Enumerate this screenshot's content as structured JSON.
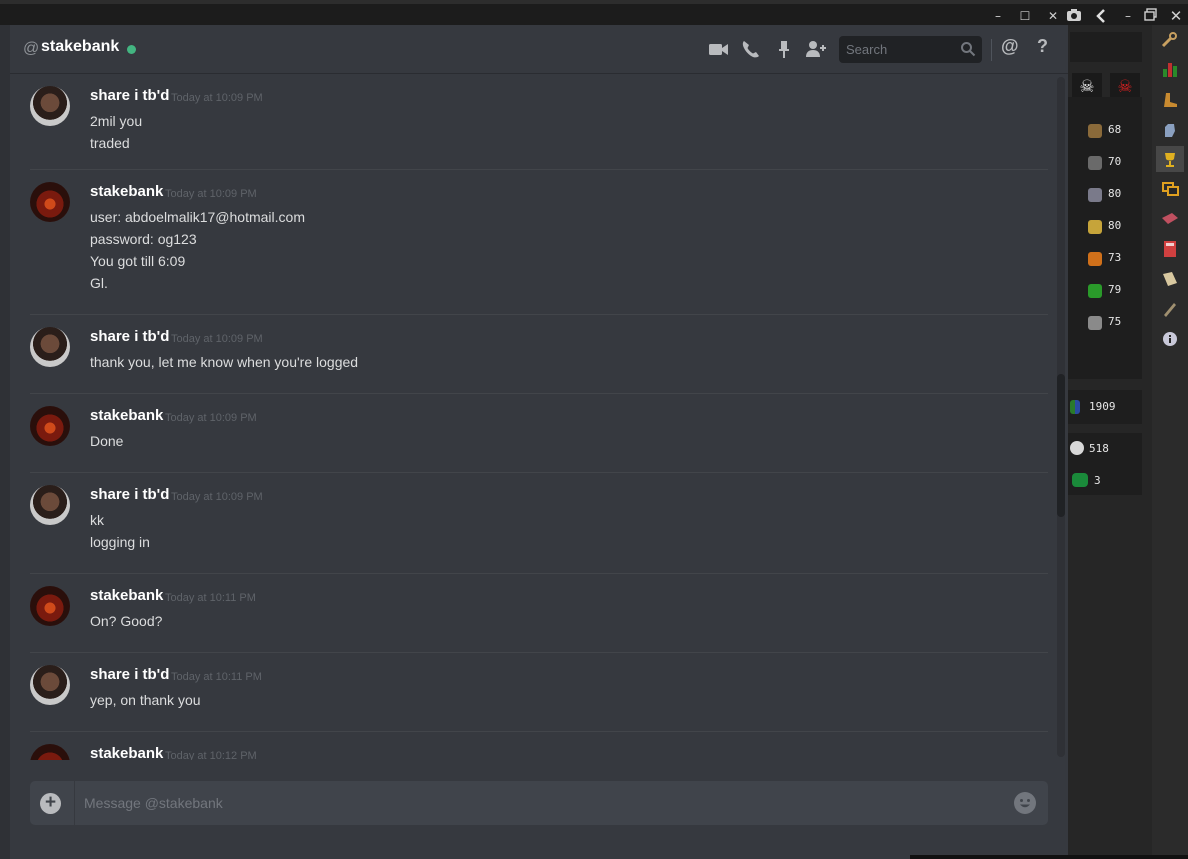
{
  "window": {
    "minimize": "–",
    "maximize": "☐",
    "close": "✕"
  },
  "header": {
    "at": "@",
    "channel": "stakebank",
    "search_placeholder": "Search",
    "mention": "@",
    "help": "?"
  },
  "messages": [
    {
      "author": "share i tb'd",
      "time": "Today at 10:09 PM",
      "avatar": "share",
      "lines": [
        "2mil you",
        "traded"
      ]
    },
    {
      "author": "stakebank",
      "time": "Today at 10:09 PM",
      "avatar": "stake",
      "lines": [
        "user: abdoelmalik17@hotmail.com",
        "password: og123",
        "You got till 6:09",
        "Gl."
      ]
    },
    {
      "author": "share i tb'd",
      "time": "Today at 10:09 PM",
      "avatar": "share",
      "lines": [
        "thank you, let me know when you're logged"
      ]
    },
    {
      "author": "stakebank",
      "time": "Today at 10:09 PM",
      "avatar": "stake",
      "lines": [
        "Done"
      ]
    },
    {
      "author": "share i tb'd",
      "time": "Today at 10:09 PM",
      "avatar": "share",
      "lines": [
        "kk",
        "logging in"
      ]
    },
    {
      "author": "stakebank",
      "time": "Today at 10:11 PM",
      "avatar": "stake",
      "lines": [
        "On? Good?"
      ]
    },
    {
      "author": "share i tb'd",
      "time": "Today at 10:11 PM",
      "avatar": "share",
      "lines": [
        "yep, on thank you"
      ]
    },
    {
      "author": "stakebank",
      "time": "Today at 10:12 PM",
      "avatar": "stake",
      "lines": []
    }
  ],
  "composer": {
    "placeholder": "Message @stakebank",
    "attach": "+"
  },
  "game_panel": {
    "stats": [
      {
        "icon": "pickaxe-icon",
        "value": "68",
        "color": "#8a6a3a"
      },
      {
        "icon": "anvil-icon",
        "value": "70",
        "color": "#6a6a6a"
      },
      {
        "icon": "fish-icon",
        "value": "80",
        "color": "#7a7a8a"
      },
      {
        "icon": "herb-icon",
        "value": "80",
        "color": "#c6a43a"
      },
      {
        "icon": "fire-icon",
        "value": "73",
        "color": "#d0701a"
      },
      {
        "icon": "tree-icon",
        "value": "79",
        "color": "#2a9a2a"
      },
      {
        "icon": "pot-icon",
        "value": "75",
        "color": "#8a8a8a"
      }
    ],
    "total": "1909",
    "kills": "518",
    "deaths": "3"
  }
}
